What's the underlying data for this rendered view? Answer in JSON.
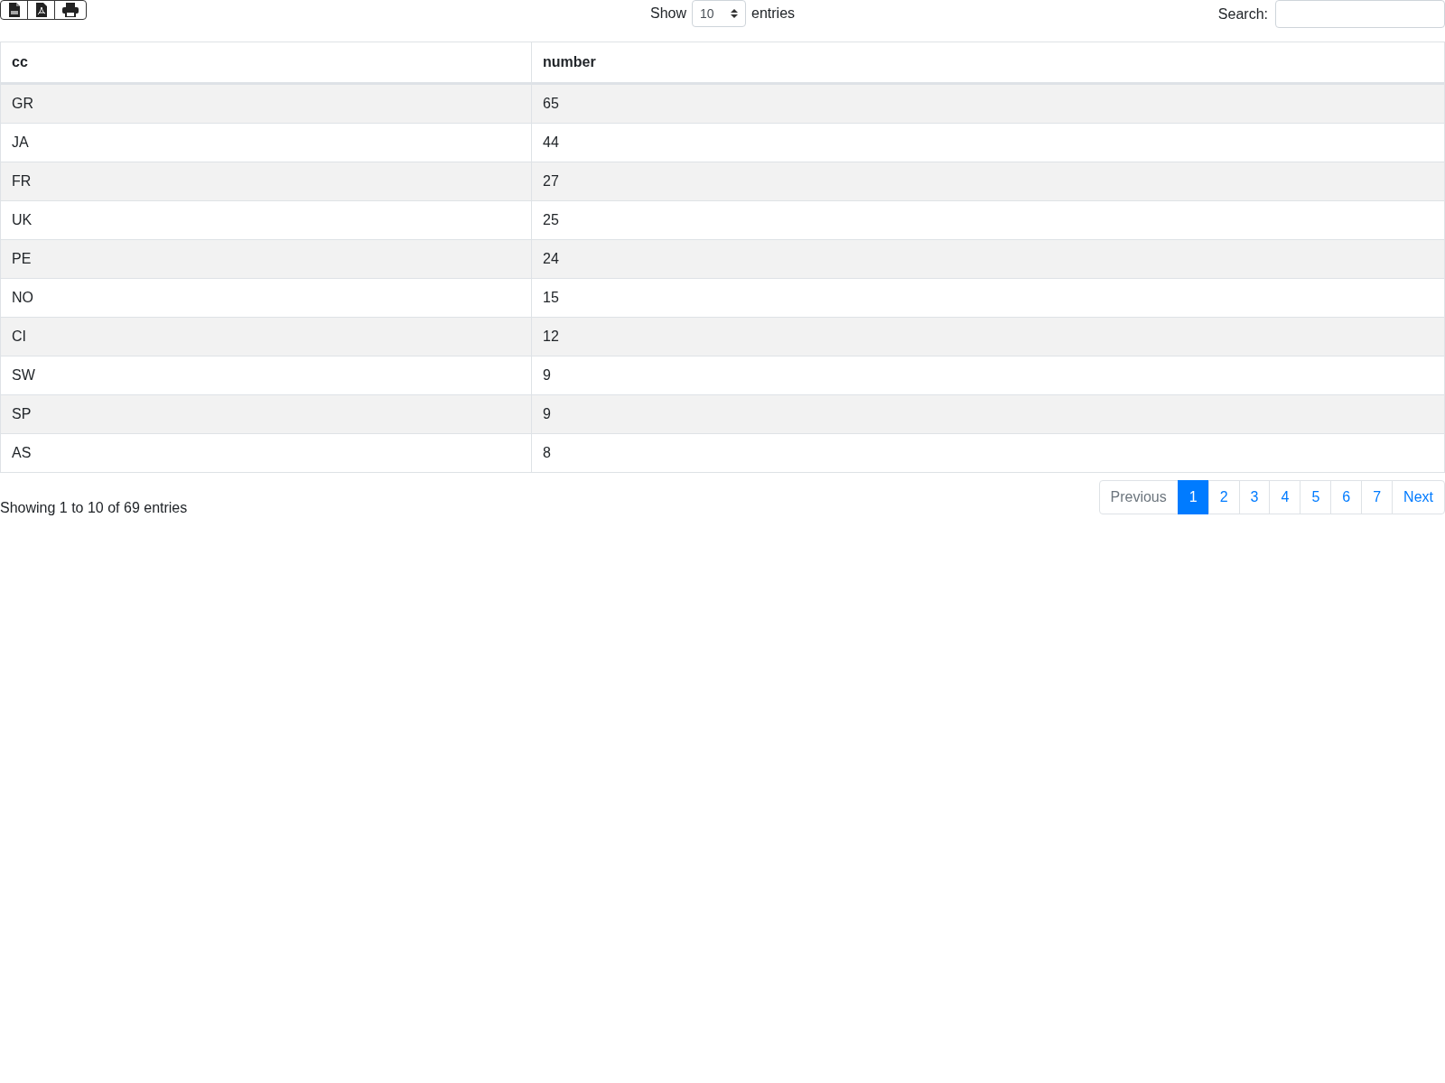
{
  "length_control": {
    "prefix": "Show",
    "value": "10",
    "suffix": "entries"
  },
  "search": {
    "label": "Search:"
  },
  "table": {
    "columns": [
      "cc",
      "number"
    ],
    "rows": [
      [
        "GR",
        "65"
      ],
      [
        "JA",
        "44"
      ],
      [
        "FR",
        "27"
      ],
      [
        "UK",
        "25"
      ],
      [
        "PE",
        "24"
      ],
      [
        "NO",
        "15"
      ],
      [
        "CI",
        "12"
      ],
      [
        "SW",
        "9"
      ],
      [
        "SP",
        "9"
      ],
      [
        "AS",
        "8"
      ]
    ]
  },
  "info": "Showing 1 to 10 of 69 entries",
  "pagination": {
    "previous": {
      "label": "Previous",
      "disabled": true
    },
    "pages": [
      {
        "label": "1",
        "selected": true
      },
      {
        "label": "2",
        "selected": false
      },
      {
        "label": "3",
        "selected": false
      },
      {
        "label": "4",
        "selected": false
      },
      {
        "label": "5",
        "selected": false
      },
      {
        "label": "6",
        "selected": false
      },
      {
        "label": "7",
        "selected": false
      }
    ],
    "next": {
      "label": "Next",
      "disabled": false
    }
  }
}
